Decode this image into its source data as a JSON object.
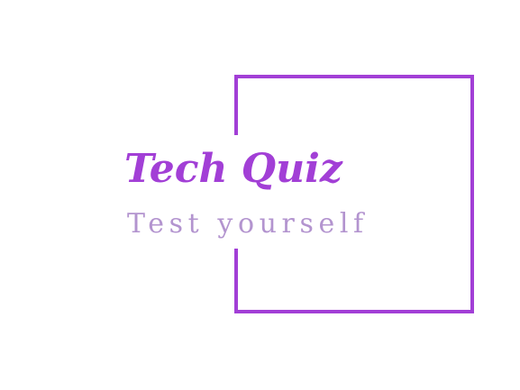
{
  "logo": {
    "title": "Tech Quiz",
    "subtitle": "Test yourself"
  },
  "colors": {
    "accent": "#a23fd6",
    "subtitle": "#b394cf",
    "background": "#ffffff"
  }
}
